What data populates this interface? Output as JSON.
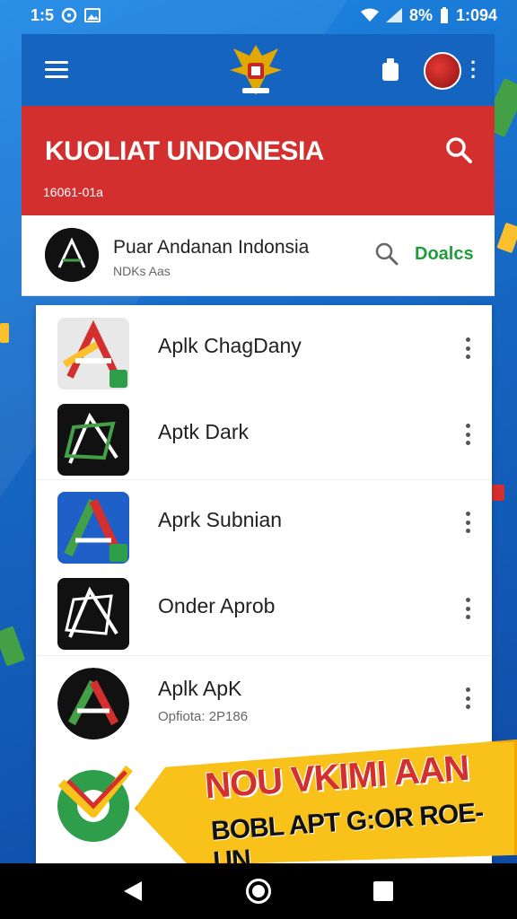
{
  "status_bar": {
    "time": "1:5",
    "battery_text": "8%",
    "clock_right": "1:094"
  },
  "header": {
    "menu_icon": "hamburger-menu-icon",
    "emblem_icon": "garuda-emblem-icon",
    "badge_icon": "battery-badge-icon",
    "avatar_icon": "profile-avatar-icon",
    "overflow_icon": "vertical-dots-icon"
  },
  "banner": {
    "title": "KUOLIAT UNDONESIA",
    "subtitle": "16061-01a",
    "search_icon": "search-icon",
    "color": "#d32f2f"
  },
  "profile": {
    "title": "Puar Andanan Indonsia",
    "subtitle": "NDKs Aas",
    "action_label": "Doalcs",
    "action_color": "#1f9d3a"
  },
  "apps": [
    {
      "name": "Aplk ChagDany",
      "meta": ""
    },
    {
      "name": "Aptk Dark",
      "meta": ""
    },
    {
      "name": "Aprk Subnian",
      "meta": ""
    },
    {
      "name": "Onder Aprob",
      "meta": ""
    },
    {
      "name": "Aplk ApK",
      "meta": "Opfiota: 2P186"
    }
  ],
  "promo": {
    "line1": "NOU VKIMI AAN",
    "line2": "BOBL APT G:OR ROE-UN",
    "color": "#f9c21a"
  },
  "nav": {
    "back_icon": "back-triangle-icon",
    "home_icon": "home-circle-icon",
    "recent_icon": "recent-square-icon"
  }
}
